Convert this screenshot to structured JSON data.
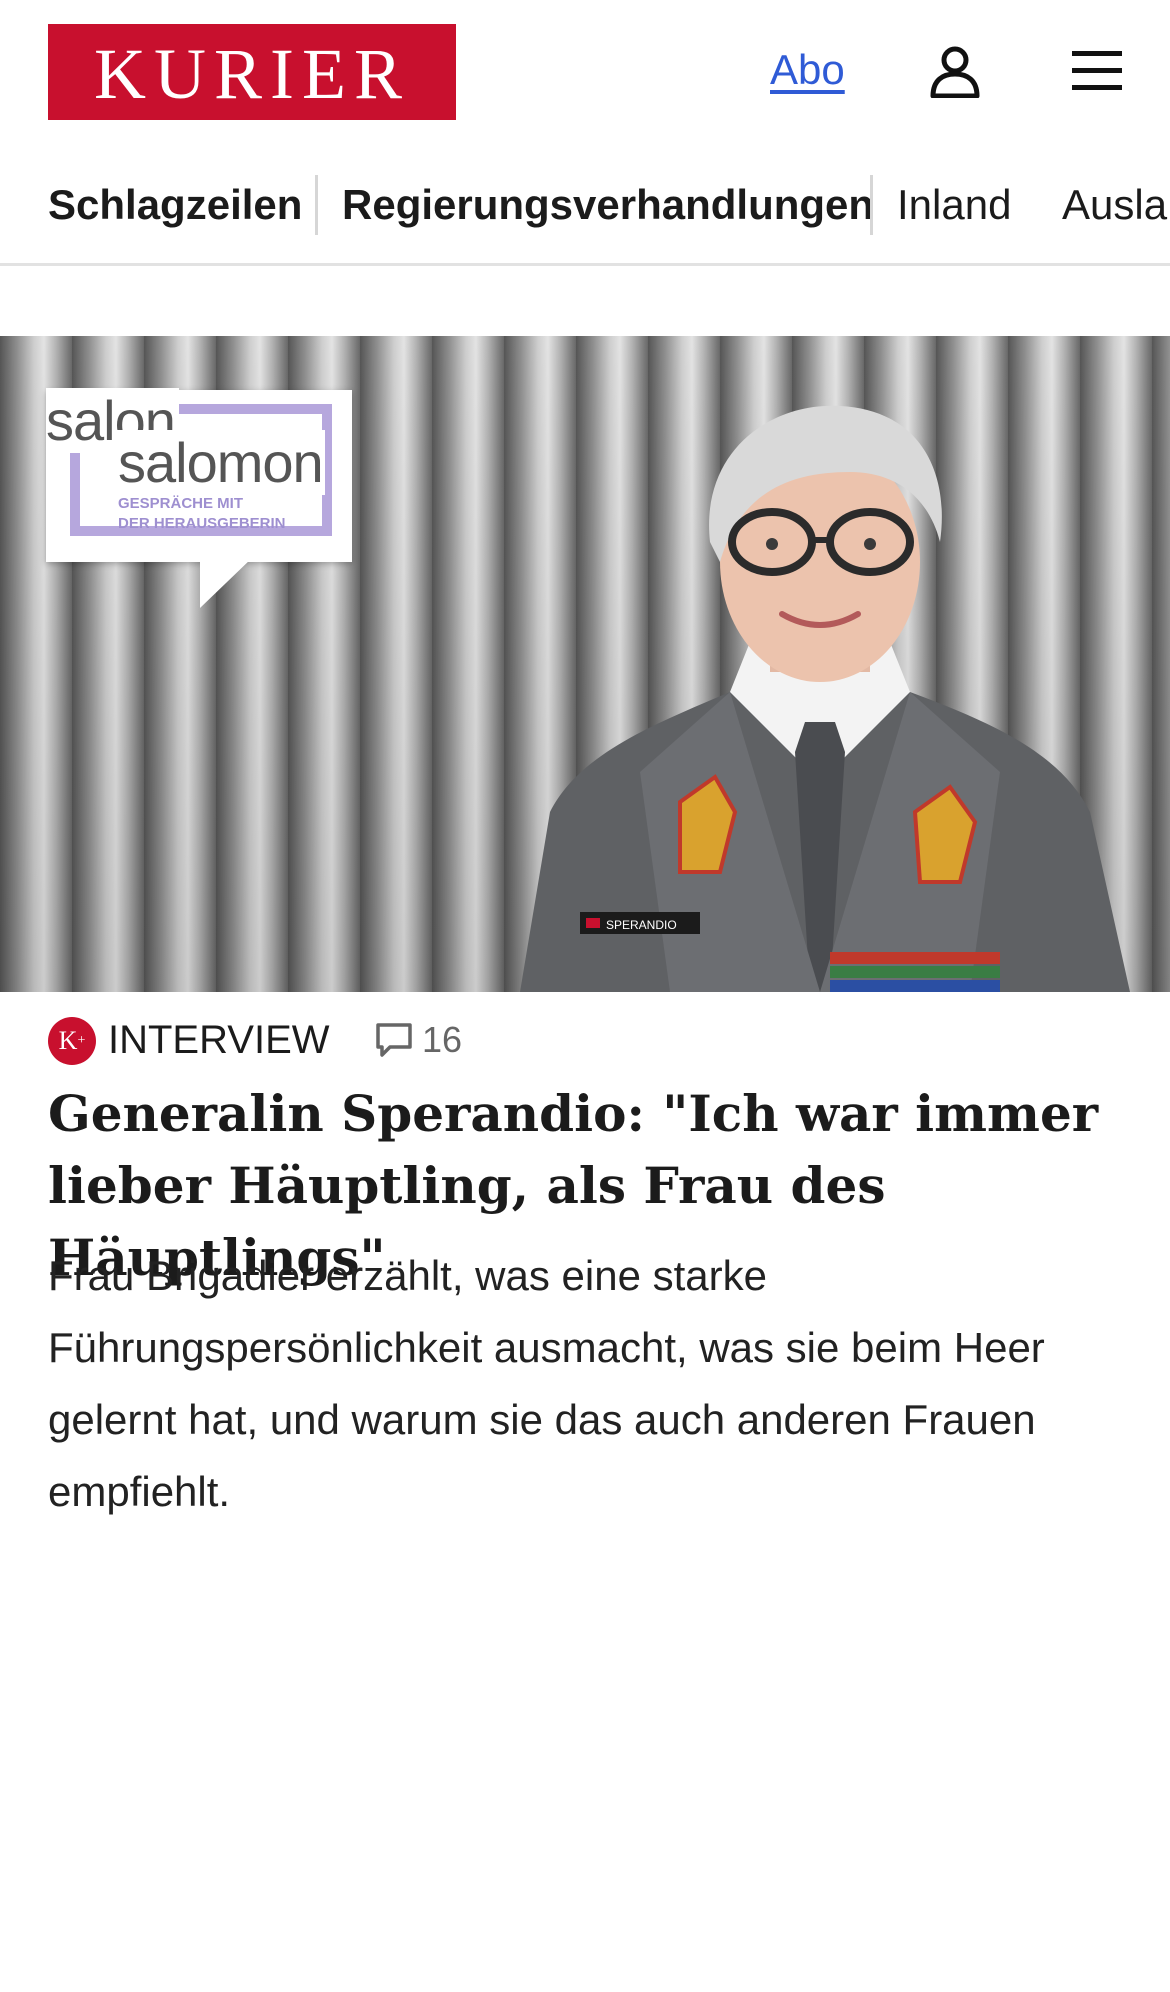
{
  "header": {
    "logo_text": "KURIER",
    "abo_label": "Abo",
    "brand_color": "#c8102e",
    "link_color": "#2f5bd6",
    "user_icon": "user-icon",
    "menu_icon": "hamburger-menu-icon"
  },
  "nav": {
    "items": [
      {
        "label": "Schlagzeilen"
      },
      {
        "label": "Regierungsverhandlungen"
      },
      {
        "label": "Inland"
      },
      {
        "label": "Ausla"
      }
    ]
  },
  "hero": {
    "badge_line1": "salon",
    "badge_line2": "salomon",
    "badge_sub1": "GESPRÄCHE MIT",
    "badge_sub2": "DER HERAUSGEBERIN",
    "name_tag": "SPERANDIO"
  },
  "article": {
    "premium_badge": "K",
    "premium_plus": "+",
    "kicker": "INTERVIEW",
    "comment_count": "16",
    "headline": "Generalin Sperandio: \"Ich war immer lie­ber Häuptling, als Frau des Häuptlings\"",
    "lead": "Frau Brigadier erzählt, was eine starke Führungspersönlichkeit ausmacht, was sie beim Heer gelernt hat, und warum sie das auch anderen Frauen empfiehlt."
  }
}
